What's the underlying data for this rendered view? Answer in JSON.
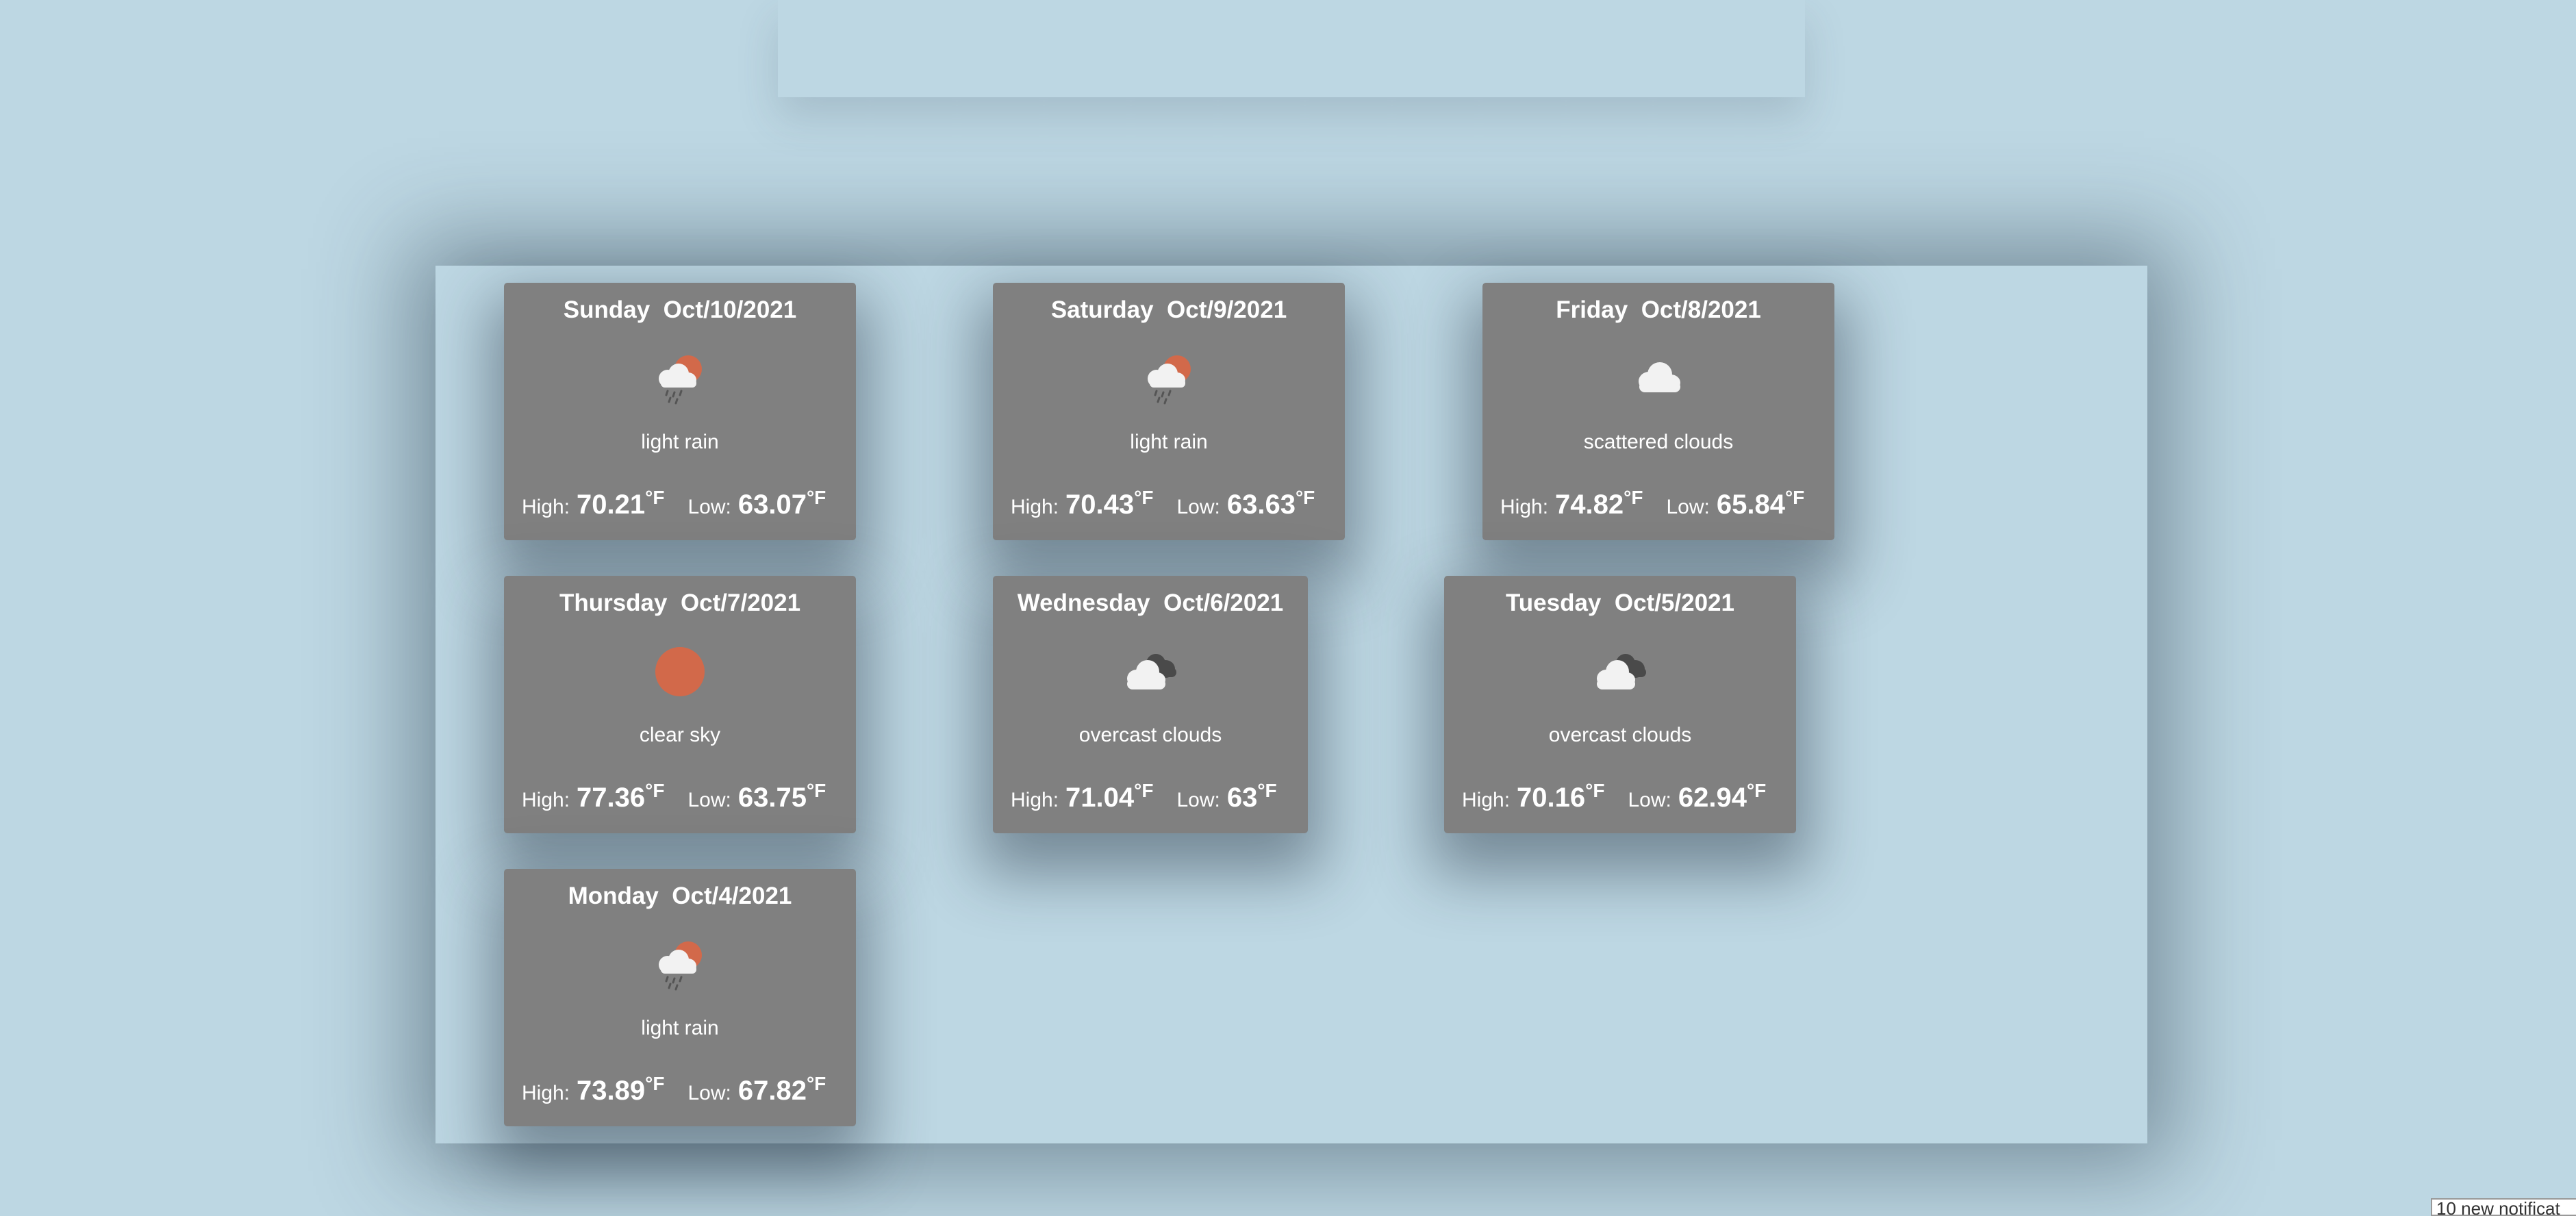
{
  "days": [
    {
      "day": "Sunday",
      "date": "Oct/10/2021",
      "icon": "light-rain-icon",
      "description": "light rain",
      "high_label": "High:",
      "high": "70.21",
      "low_label": "Low:",
      "low": "63.07",
      "unit": "°F"
    },
    {
      "day": "Saturday",
      "date": "Oct/9/2021",
      "icon": "light-rain-icon",
      "description": "light rain",
      "high_label": "High:",
      "high": "70.43",
      "low_label": "Low:",
      "low": "63.63",
      "unit": "°F"
    },
    {
      "day": "Friday",
      "date": "Oct/8/2021",
      "icon": "scattered-clouds-icon",
      "description": "scattered clouds",
      "high_label": "High:",
      "high": "74.82",
      "low_label": "Low:",
      "low": "65.84",
      "unit": "°F"
    },
    {
      "day": "Thursday",
      "date": "Oct/7/2021",
      "icon": "clear-sky-icon",
      "description": "clear sky",
      "high_label": "High:",
      "high": "77.36",
      "low_label": "Low:",
      "low": "63.75",
      "unit": "°F"
    },
    {
      "day": "Wednesday",
      "date": "Oct/6/2021",
      "icon": "overcast-clouds-icon",
      "description": "overcast clouds",
      "high_label": "High:",
      "high": "71.04",
      "low_label": "Low:",
      "low": "63",
      "unit": "°F"
    },
    {
      "day": "Tuesday",
      "date": "Oct/5/2021",
      "icon": "overcast-clouds-icon",
      "description": "overcast clouds",
      "high_label": "High:",
      "high": "70.16",
      "low_label": "Low:",
      "low": "62.94",
      "unit": "°F"
    },
    {
      "day": "Monday",
      "date": "Oct/4/2021",
      "icon": "light-rain-icon",
      "description": "light rain",
      "high_label": "High:",
      "high": "73.89",
      "low_label": "Low:",
      "low": "67.82",
      "unit": "°F"
    }
  ],
  "notification": "10 new notificat",
  "colors": {
    "background": "#bdd7e3",
    "card": "#808080",
    "sun": "#d2694a",
    "cloud": "#f2f2f2",
    "dark_cloud": "#4a4a4a"
  }
}
